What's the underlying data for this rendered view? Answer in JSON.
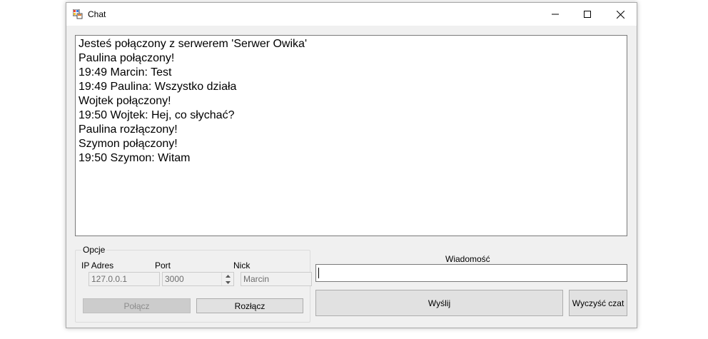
{
  "window": {
    "title": "Chat",
    "icon": "app-icon"
  },
  "title_controls": {
    "minimize": "minimize-icon",
    "maximize": "maximize-icon",
    "close": "close-icon"
  },
  "chat_log": {
    "lines": [
      "Jesteś połączony z serwerem 'Serwer Owika'",
      "Paulina połączony!",
      "19:49 Marcin: Test",
      "19:49 Paulina: Wszystko działa",
      "Wojtek połączony!",
      "19:50 Wojtek: Hej, co słychać?",
      "Paulina rozłączony!",
      "Szymon połączony!",
      "19:50 Szymon: Witam"
    ]
  },
  "options": {
    "group_label": "Opcje",
    "ip_label": "IP Adres",
    "ip_value": "127.0.0.1",
    "port_label": "Port",
    "port_value": "3000",
    "nick_label": "Nick",
    "nick_value": "Marcin",
    "connect_label": "Połącz",
    "disconnect_label": "Rozłącz"
  },
  "message": {
    "label": "Wiadomość",
    "value": "",
    "send_label": "Wyślij",
    "clear_label": "Wyczyść czat"
  }
}
